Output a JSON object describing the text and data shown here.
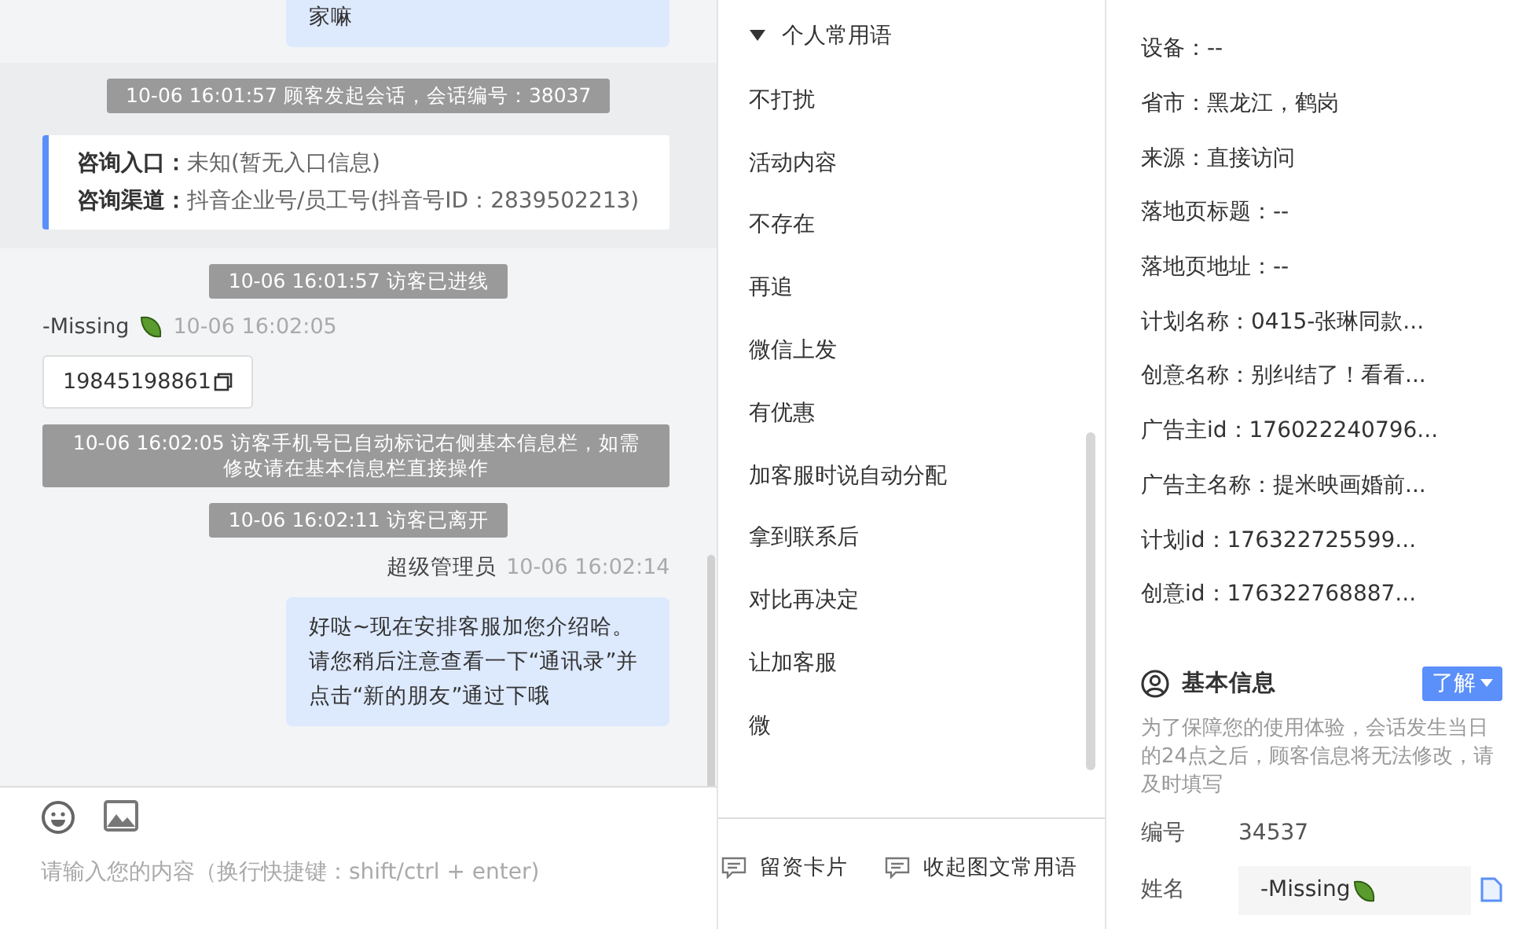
{
  "chat": {
    "messages": [
      {
        "kind": "agent_tail",
        "text": "家嘛"
      },
      {
        "kind": "session",
        "notice": "10-06 16:01:57 顾客发起会话，会话编号：38037",
        "fields": [
          {
            "label": "咨询入口：",
            "value": "未知(暂无入口信息)"
          },
          {
            "label": "咨询渠道：",
            "value": "抖音企业号/员工号(抖音号ID：2839502213)"
          }
        ]
      },
      {
        "kind": "system",
        "text": "10-06 16:01:57 访客已进线"
      },
      {
        "kind": "visitor",
        "sender": "-Missing",
        "time": "10-06 16:02:05",
        "text": "19845198861"
      },
      {
        "kind": "system",
        "text": "10-06 16:02:05 访客手机号已自动标记右侧基本信息栏，如需修改请在基本信息栏直接操作"
      },
      {
        "kind": "system",
        "text": "10-06 16:02:11 访客已离开"
      },
      {
        "kind": "agent",
        "sender": "超级管理员",
        "time": "10-06 16:02:14",
        "text": "好哒~现在安排客服加您介绍哈。请您稍后注意查看一下“通讯录”并点击“新的朋友”通过下哦"
      }
    ],
    "input": {
      "placeholder": "请输入您的内容（换行快捷键：shift/ctrl + enter)"
    }
  },
  "phrases": {
    "group": {
      "label": "个人常用语",
      "expanded": true
    },
    "items": [
      "不打扰",
      "活动内容",
      "不存在",
      "再追",
      "微信上发",
      "有优惠",
      "加客服时说自动分配",
      "拿到联系后",
      "对比再决定",
      "让加客服",
      "微"
    ],
    "actions": [
      "留资卡片",
      "收起图文常用语"
    ]
  },
  "info": {
    "rows": [
      "设备：--",
      "省市：黑龙江，鹤岗",
      "来源：直接访问",
      "落地页标题：--",
      "落地页地址：--",
      "计划名称：0415-张琳同款...",
      "创意名称：别纠结了！看看...",
      "广告主id：176022240796...",
      "广告主名称：提米映画婚前...",
      "计划id：176322725599...",
      "创意id：176322768887..."
    ],
    "basic": {
      "title": "基本信息",
      "button": "了解",
      "note": "为了保障您的使用体验，会话发生当日的24点之后，顾客信息将无法修改，请及时填写",
      "fields": [
        {
          "kind": "text",
          "label": "编号",
          "value": "34537"
        },
        {
          "kind": "input",
          "label": "姓名",
          "value": "-Missing"
        }
      ]
    }
  }
}
